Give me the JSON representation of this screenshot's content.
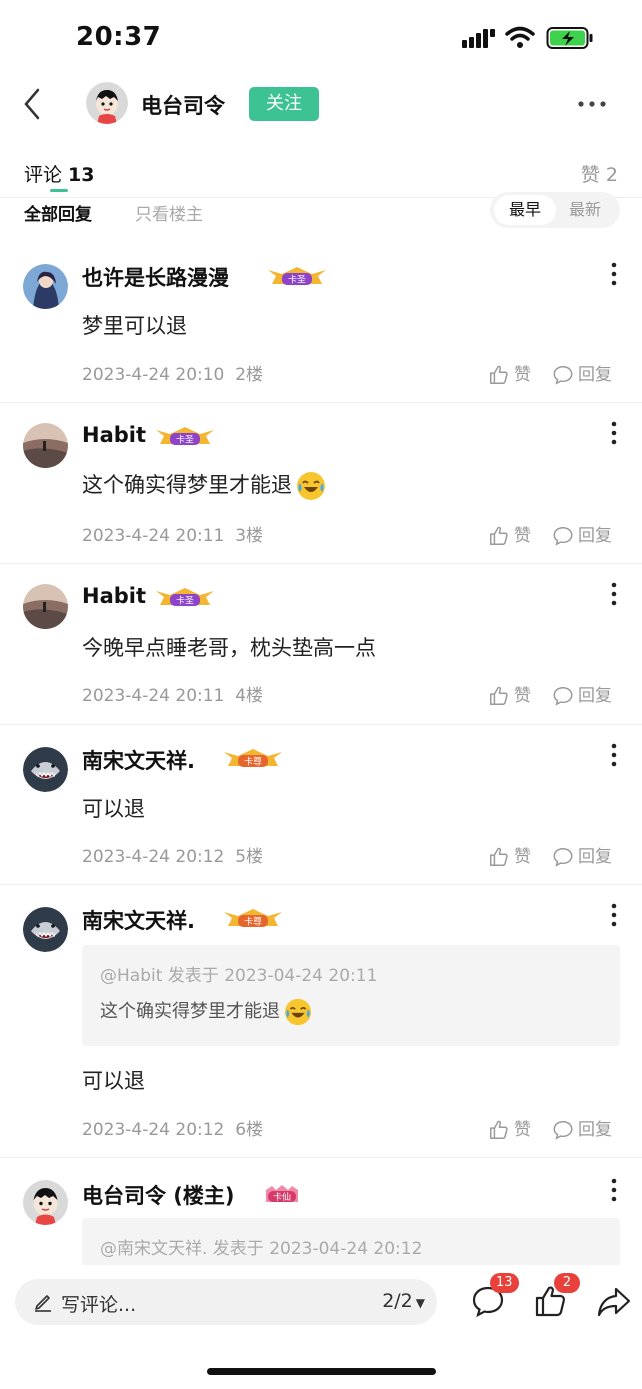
{
  "status_bar": {
    "time": "20:37"
  },
  "header": {
    "host_name": "电台司令",
    "follow_label": "关注"
  },
  "tabs": {
    "comments_label": "评论",
    "comments_count": "13",
    "likes_label": "赞",
    "likes_count": "2"
  },
  "filters": {
    "all": "全部回复",
    "host_only": "只看楼主",
    "sort_earliest": "最早",
    "sort_latest": "最新"
  },
  "actions": {
    "like": "赞",
    "reply": "回复"
  },
  "comments": [
    {
      "name": "也许是长路漫漫",
      "text": "梦里可以退",
      "time": "2023-4-24 20:10",
      "floor": "2楼",
      "badge": "卡圣",
      "avatar_icon": "anime-avatar-icon"
    },
    {
      "name": "Habit",
      "text": "这个确实得梦里才能退",
      "emoji": "laugh-cry-emoji",
      "time": "2023-4-24 20:11",
      "floor": "3楼",
      "badge": "卡圣",
      "avatar_icon": "landscape-avatar-icon"
    },
    {
      "name": "Habit",
      "text": "今晚早点睡老哥，枕头垫高一点",
      "time": "2023-4-24 20:11",
      "floor": "4楼",
      "badge": "卡圣",
      "avatar_icon": "landscape-avatar-icon"
    },
    {
      "name": "南宋文天祥.",
      "text": "可以退",
      "time": "2023-4-24 20:12",
      "floor": "5楼",
      "badge": "卡尊",
      "avatar_icon": "shark-avatar-icon"
    },
    {
      "name": "南宋文天祥.",
      "quote_head": "@Habit 发表于 2023-04-24 20:11",
      "quote_text": "这个确实得梦里才能退",
      "quote_emoji": "laugh-cry-emoji",
      "text": "可以退",
      "time": "2023-4-24 20:12",
      "floor": "6楼",
      "badge": "卡尊",
      "avatar_icon": "shark-avatar-icon"
    },
    {
      "name": "电台司令 (楼主)",
      "quote_head": "@南宋文天祥. 发表于 2023-04-24 20:12",
      "badge": "卡仙",
      "avatar_icon": "cartoon-avatar-icon"
    }
  ],
  "bottom_bar": {
    "write_placeholder": "写评论...",
    "page_indicator": "2/2",
    "comment_count": "13",
    "like_count": "2"
  },
  "colors": {
    "accent": "#3cc293",
    "badge_red": "#e8403b"
  }
}
